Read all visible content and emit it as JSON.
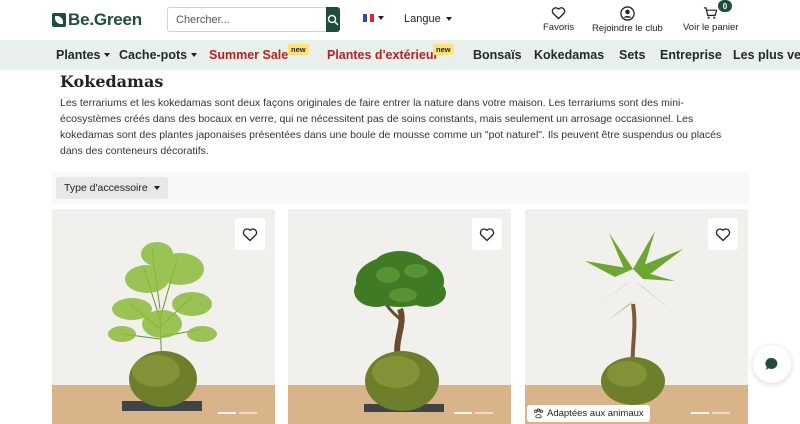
{
  "header": {
    "logo_text": "Be.Green",
    "search_placeholder": "Chercher...",
    "flag_label": "FR",
    "language_label": "Langue",
    "favorites_label": "Favoris",
    "club_label": "Rejoindre le club",
    "cart_label": "Voir le panier",
    "cart_count": "0"
  },
  "nav": {
    "items": [
      {
        "label": "Plantes"
      },
      {
        "label": "Cache-pots"
      },
      {
        "label": "Summer Sale",
        "badge": "new"
      },
      {
        "label": "Plantes d'extérieur",
        "badge": "new"
      },
      {
        "label": "Bonsaïs"
      },
      {
        "label": "Kokedamas"
      },
      {
        "label": "Sets"
      },
      {
        "label": "Entreprise"
      },
      {
        "label": "Les plus ven"
      }
    ]
  },
  "main": {
    "title": "Kokedamas",
    "intro": "Les terrariums et les kokedamas sont deux façons originales de faire entrer la nature dans votre maison. Les terrariums sont des mini-écosystèmes créés dans des bocaux en verre, qui ne nécessitent pas de soins constants, mais seulement un arrosage occasionnel. Les kokedamas sont des plantes japonaises présentées dans une boule de mousse comme un \"pot naturel\". Ils peuvent être suspendus ou placés dans des conteneurs décoratifs.",
    "filter_label": "Type d'accessoire"
  },
  "products": [
    {
      "plant": "asparagus-fern-kokedama",
      "badge": ""
    },
    {
      "plant": "bonsai-ficus-kokedama",
      "badge": ""
    },
    {
      "plant": "pachira-kokedama",
      "badge": "Adaptées aux animaux"
    }
  ],
  "colors": {
    "brand": "#1f4d3a",
    "nav_bg": "#e9efeb",
    "sale_red": "#b32424",
    "new_badge": "#ffe27a"
  }
}
